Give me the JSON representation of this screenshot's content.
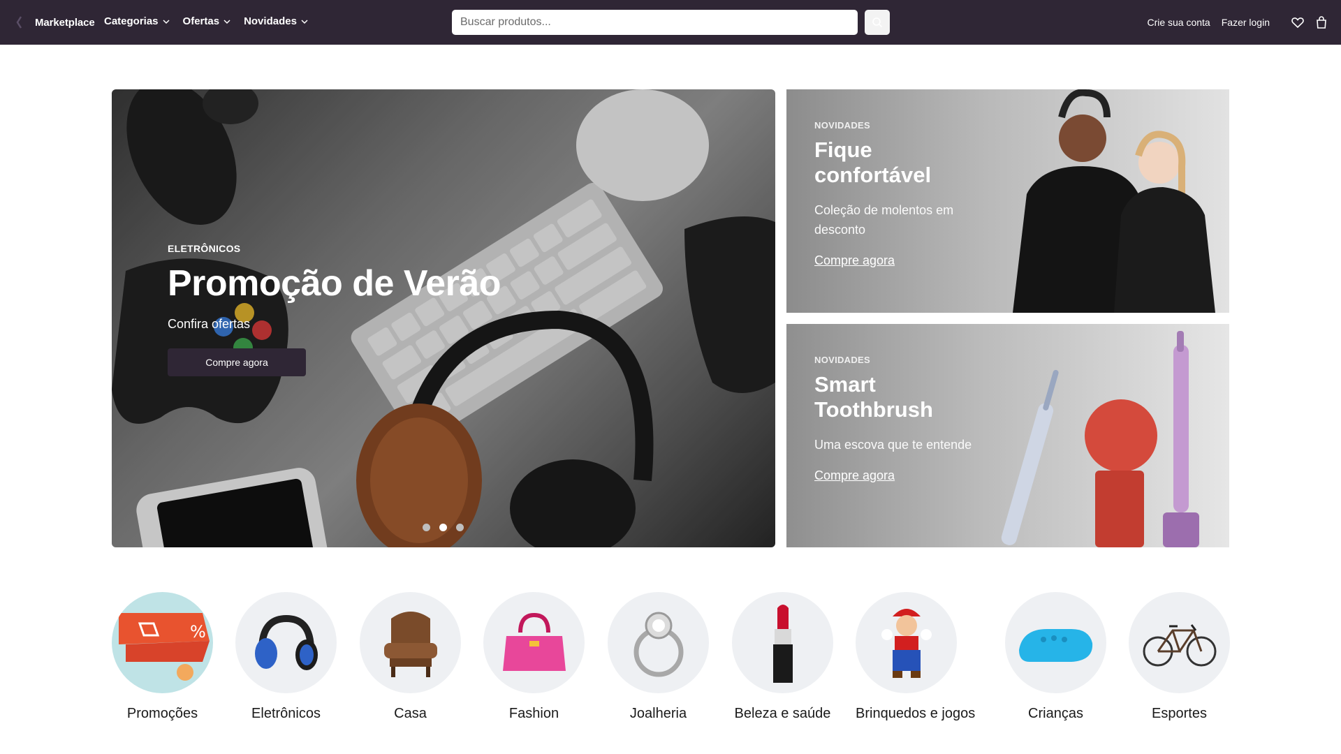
{
  "colors": {
    "nav_bg": "#2f2635",
    "cta_bg": "#2f2635",
    "category_bg": "#eef0f3"
  },
  "nav": {
    "brand": "Marketplace",
    "menus": [
      {
        "label": "Categorias",
        "icon": "chevron-down-icon"
      },
      {
        "label": "Ofertas",
        "icon": "chevron-down-icon"
      },
      {
        "label": "Novidades",
        "icon": "chevron-down-icon"
      }
    ],
    "search": {
      "placeholder": "Buscar produtos...",
      "value": "",
      "icon": "search-icon"
    },
    "create_account": "Crie sua conta",
    "login": "Fazer login",
    "icons": [
      "heart-icon",
      "shopping-bag-icon"
    ]
  },
  "hero": {
    "eyebrow": "ELETRÔNICOS",
    "title": "Promoção de Verão",
    "subtitle": "Confira ofertas",
    "cta": "Compre agora",
    "slide_count": 3,
    "active_slide": 2
  },
  "promos": [
    {
      "eyebrow": "NOVIDADES",
      "title": "Fique confortável",
      "subtitle": "Coleção de molentos em desconto",
      "link": "Compre agora"
    },
    {
      "eyebrow": "NOVIDADES",
      "title": "Smart Toothbrush",
      "subtitle": "Uma escova que te entende",
      "link": "Compre agora"
    }
  ],
  "categories": [
    {
      "label": "Promoções",
      "icon": "sale-tag-icon"
    },
    {
      "label": "Eletrônicos",
      "icon": "headphones-icon"
    },
    {
      "label": "Casa",
      "icon": "armchair-icon"
    },
    {
      "label": "Fashion",
      "icon": "handbag-icon"
    },
    {
      "label": "Joalheria",
      "icon": "ring-icon"
    },
    {
      "label": "Beleza e saúde",
      "icon": "lipstick-icon"
    },
    {
      "label": "Brinquedos e jogos",
      "icon": "toy-figure-icon"
    },
    {
      "label": "Crianças",
      "icon": "clog-shoe-icon"
    },
    {
      "label": "Esportes",
      "icon": "bicycle-icon"
    }
  ]
}
